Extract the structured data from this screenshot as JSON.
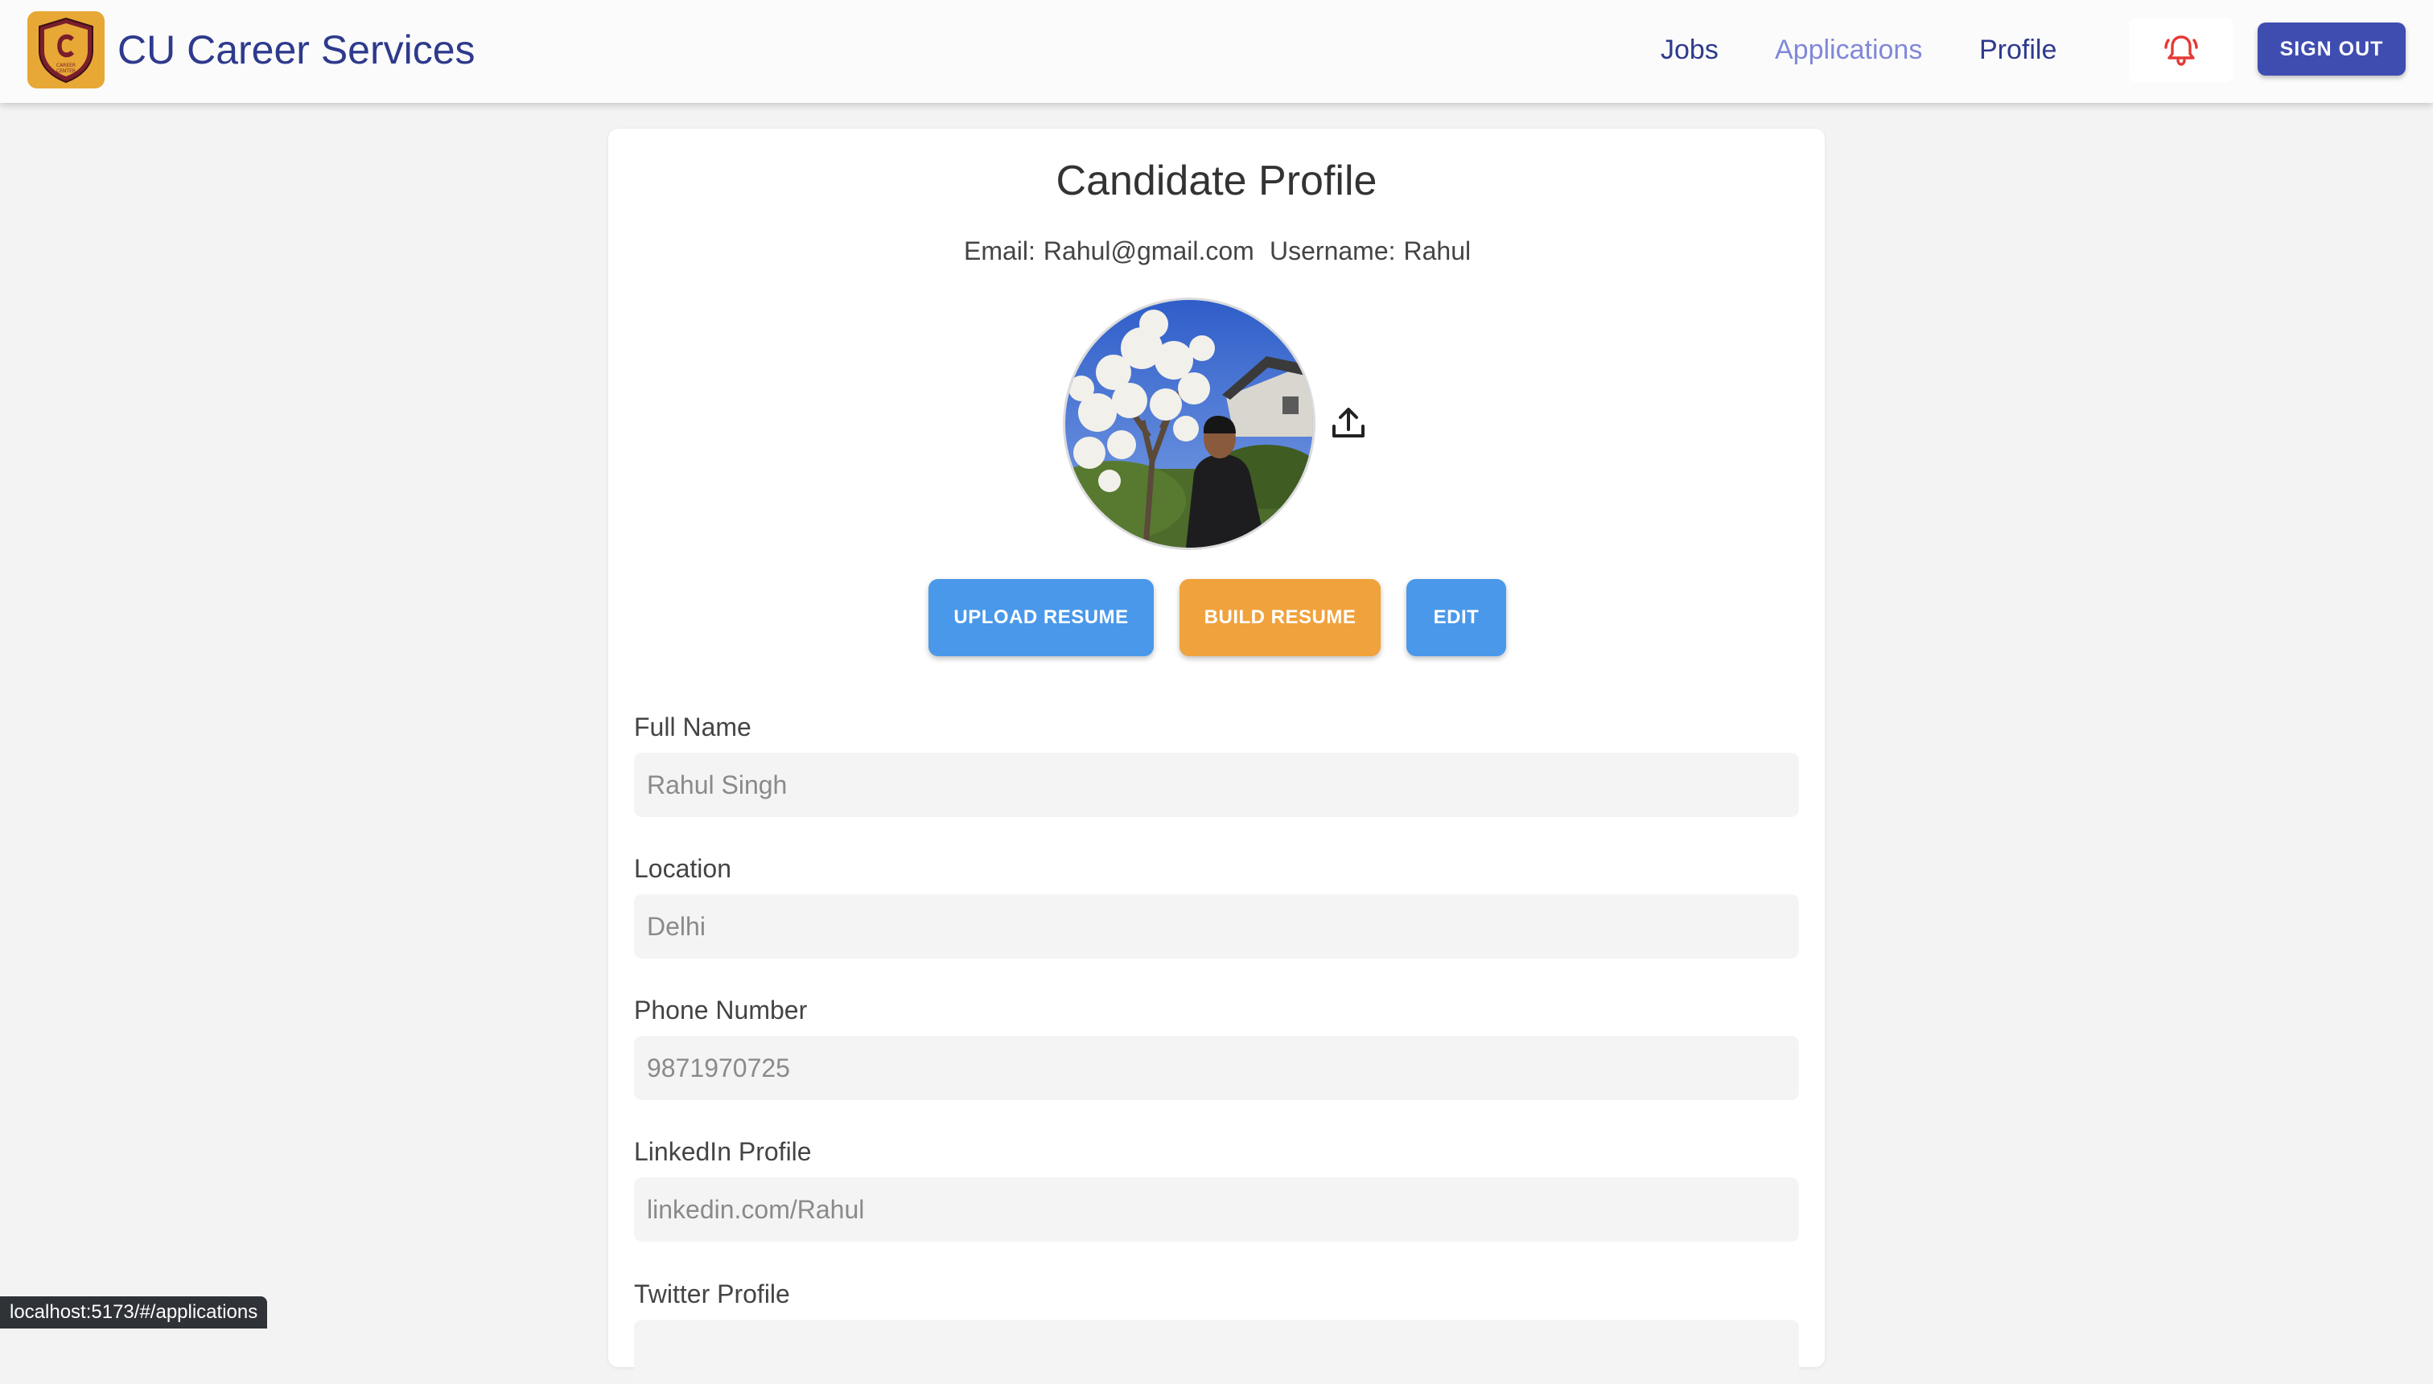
{
  "header": {
    "logo_icon": "cu-career-center-shield-icon",
    "logo_text_top": "CAREER",
    "logo_text_bottom": "CENTER",
    "title": "CU Career Services",
    "nav": [
      {
        "label": "Jobs"
      },
      {
        "label": "Applications"
      },
      {
        "label": "Profile"
      }
    ],
    "notification_icon": "bell-ringing-icon",
    "sign_out_label": "SIGN OUT"
  },
  "profile": {
    "title": "Candidate Profile",
    "email_label": "Email:",
    "email": "Rahul@gmail.com",
    "username_label": "Username:",
    "username": "Rahul",
    "avatar_icon": "profile-photo",
    "upload_photo_icon": "upload-icon",
    "buttons": {
      "upload_resume": "UPLOAD RESUME",
      "build_resume": "BUILD RESUME",
      "edit": "EDIT"
    },
    "fields": [
      {
        "label": "Full Name",
        "value": "Rahul Singh"
      },
      {
        "label": "Location",
        "value": "Delhi"
      },
      {
        "label": "Phone Number",
        "value": "9871970725"
      },
      {
        "label": "LinkedIn Profile",
        "value": "linkedin.com/Rahul"
      },
      {
        "label": "Twitter Profile",
        "value": ""
      }
    ]
  },
  "status_bar": {
    "url": "localhost:5173/#/applications"
  },
  "colors": {
    "brand_navy": "#2e3a8c",
    "nav_active": "#8188d8",
    "sign_out_bg": "#3f4db0",
    "primary_blue": "#4a98ea",
    "orange": "#f0a23c",
    "logo_gold": "#e8a836",
    "bell_red": "#e53935"
  }
}
